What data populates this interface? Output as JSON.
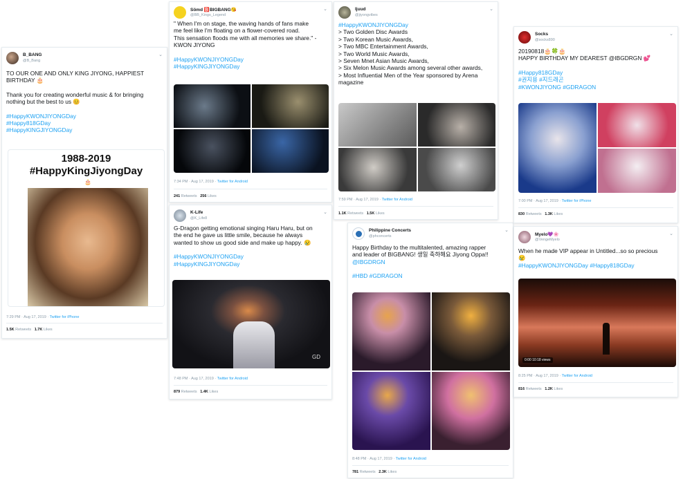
{
  "tweets": [
    {
      "user": "B_BANG",
      "handle": "@B_Bang",
      "lines": [
        "TO OUR ONE AND ONLY KING JIYONG, HAPPIEST",
        "BIRTHDAY 🎂",
        "",
        "Thank you for creating wonderful music & for bringing",
        "nothing but the best to us 😊",
        "",
        "#HappyKWONJIYONGDay",
        "#Happy818GDay",
        "#HappyKINGJIYONGDay"
      ],
      "media_title": "1988-2019",
      "media_subtitle": "#HappyKingJiyongDay",
      "time": "7:29 PM · Aug 17, 2019 · ",
      "source": "Twitter for iPhone",
      "retweets": "1.5K",
      "retweets_label": " Retweets",
      "likes": "1.7K",
      "likes_label": " Likes"
    },
    {
      "user": "Sömd 🅱️BIGBANG😘",
      "handle": "@BB_Kings_Legend",
      "lines": [
        "\" When I'm on stage, the waving hands of fans make",
        "me feel like I'm floating on a flower-covered road.",
        "This sensation floods me with all memories we share.\" -",
        "KWON JIYONG",
        "",
        "#HappyKWONJIYONGDay",
        "#HappyKINGJIYONGDay"
      ],
      "time": "7:34 PM · Aug 17, 2019 · ",
      "source": "Twitter for Android",
      "retweets": "241",
      "retweets_label": " Retweets",
      "likes": "256",
      "likes_label": " Likes"
    },
    {
      "user": "K-Life",
      "handle": "@K_Life8",
      "lines": [
        "G-Dragon getting emotional singing Haru Haru, but on",
        "the end he gave us little smile, because he always",
        "wanted to show us good side and make up happy. 😢",
        "",
        "#HappyKWONJIYONGDay",
        "#HappyKINGJIYONGDay"
      ],
      "watermark": "GD",
      "time": "7:48 PM · Aug 17, 2019 · ",
      "source": "Twitter for Android",
      "retweets": "879",
      "retweets_label": " Retweets",
      "likes": "1.4K",
      "likes_label": " Likes"
    },
    {
      "user": "Ijuud",
      "handle": "@jiyongvibes",
      "lines": [
        "#HappyKWONJIYONGDay",
        "> Two Golden Disc Awards",
        "> Two Korean Music Awards,",
        "> Two MBC Entertainment Awards,",
        "> Two World Music Awards,",
        "> Seven Mnet Asian Music Awards,",
        "> Six Melon Music Awards among several other awards,",
        "> Most Influential Men of the Year sponsored by Arena",
        "magazine"
      ],
      "time": "7:59 PM · Aug 17, 2019 · ",
      "source": "Twitter for Android",
      "retweets": "1.1K",
      "retweets_label": " Retweets",
      "likes": "1.5K",
      "likes_label": " Likes"
    },
    {
      "user": "Philippine Concerts",
      "handle": "@phconcerts",
      "lines": [
        "Happy Birthday to the multitalented, amazing rapper",
        "and leader of BIGBANG! 생일 축하해요 Jiyong Oppa!!",
        "@IBGDRGN",
        "",
        "#HBD #GDRAGON"
      ],
      "time": "8:48 PM · Aug 17, 2019 · ",
      "source": "Twitter for Android",
      "retweets": "781",
      "retweets_label": " Retweets",
      "likes": "2.3K",
      "likes_label": " Likes"
    },
    {
      "user": "Socks",
      "handle": "@socks890",
      "lines": [
        "20190818🎂🍀🎂",
        "HAPPY BIRTHDAY MY DEAREST @IBGDRGN 💕",
        "",
        "#Happy818GDay",
        "#권지용 #지드래곤",
        "#KWONJIYONG #GDRAGON"
      ],
      "time": "7:00 PM · Aug 17, 2019 · ",
      "source": "Twitter for iPhone",
      "retweets": "830",
      "retweets_label": " Retweets",
      "likes": "1.3K",
      "likes_label": " Likes"
    },
    {
      "user": "Myelo💜🌸",
      "handle": "@VengeMyelo",
      "lines": [
        "When he made VIP appear in Untitled...so so precious",
        "😢",
        "#HappyKWONJIYONGDay #Happy818GDay"
      ],
      "video_time": "0:00    10:18 views",
      "time": "8:25 PM · Aug 17, 2019 · ",
      "source": "Twitter for Android",
      "retweets": "816",
      "retweets_label": " Retweets",
      "likes": "1.2K",
      "likes_label": " Likes"
    }
  ],
  "chevron": "⌄",
  "colors": {
    "link": "#1da1f2",
    "muted": "#8899a6",
    "border": "#e6ecf0"
  }
}
